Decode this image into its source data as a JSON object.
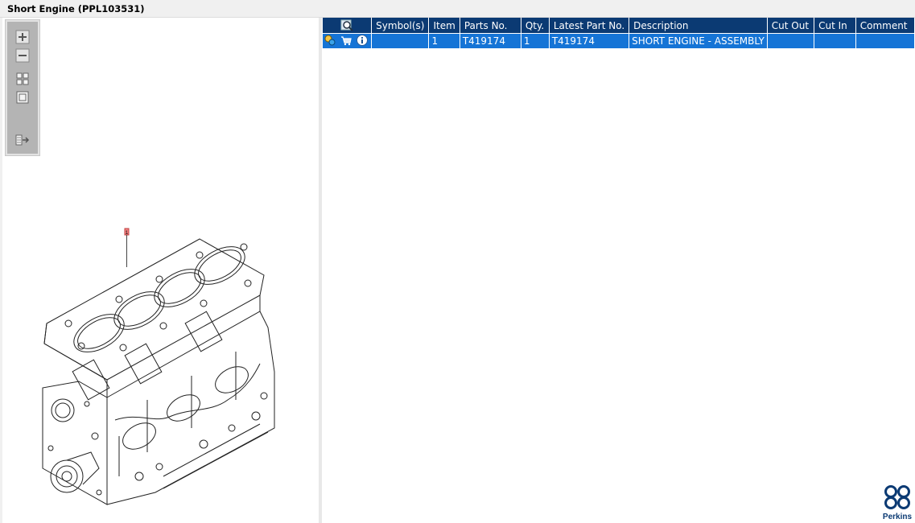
{
  "window": {
    "title": "Short Engine (PPL103531)"
  },
  "toolbar": {
    "buttons": [
      {
        "name": "zoom-in-icon"
      },
      {
        "name": "zoom-out-icon"
      },
      {
        "name": "fit-all-icon"
      },
      {
        "name": "actual-size-icon"
      },
      {
        "name": "export-icon"
      }
    ]
  },
  "drawing": {
    "callout": "1"
  },
  "table": {
    "header_icon": "search-view-icon",
    "columns": [
      "Symbol(s)",
      "Item",
      "Parts No.",
      "Qty.",
      "Latest Part No.",
      "Description",
      "Cut Out",
      "Cut In",
      "Comment"
    ],
    "rows": [
      {
        "icons": [
          "part-status-icon",
          "cart-icon",
          "info-icon"
        ],
        "symbols": "",
        "item": "1",
        "part_no": "T419174",
        "qty": "1",
        "latest_part_no": "T419174",
        "description": "SHORT ENGINE - ASSEMBLY",
        "cut_out": "",
        "cut_in": "",
        "comment": ""
      }
    ]
  },
  "brand": {
    "name": "Perkins",
    "color": "#0b3a73"
  },
  "colors": {
    "header_bg": "#0b3a73",
    "selected_row": "#1574d6"
  }
}
